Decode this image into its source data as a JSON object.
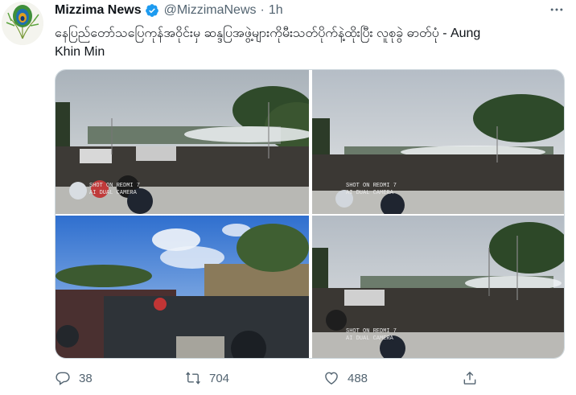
{
  "tweet": {
    "author_name": "Mizzima News",
    "handle": "@MizzimaNews",
    "separator": "·",
    "time": "1h",
    "text": "နေပြည်တော်သပြေကုန်အဝိုင်းမှ ဆန္ဒပြအဖွဲ့များကိုမီးသတ်ပိုက်နဲ့ထိုးပြီး လူစုခွဲ ဓာတ်ပုံ - Aung Khin Min",
    "photos": [
      {
        "watermark_line1": "SHOT ON REDMI 7",
        "watermark_line2": "AI DUAL CAMERA"
      },
      {
        "watermark_line1": "SHOT ON REDMI 7",
        "watermark_line2": "AI DUAL CAMERA"
      },
      {
        "watermark_line1": "",
        "watermark_line2": ""
      },
      {
        "watermark_line1": "SHOT ON REDMI 7",
        "watermark_line2": "AI DUAL CAMERA"
      }
    ],
    "actions": {
      "reply_count": "38",
      "retweet_count": "704",
      "like_count": "488"
    }
  },
  "icons": {
    "avatar": "peacock-feather-icon",
    "verified": "verified-badge-icon",
    "more": "more-options-icon",
    "reply": "reply-icon",
    "retweet": "retweet-icon",
    "like": "heart-icon",
    "share": "share-icon"
  },
  "colors": {
    "text_primary": "#0f1419",
    "text_secondary": "#536471",
    "verified_blue": "#1d9bf0"
  }
}
